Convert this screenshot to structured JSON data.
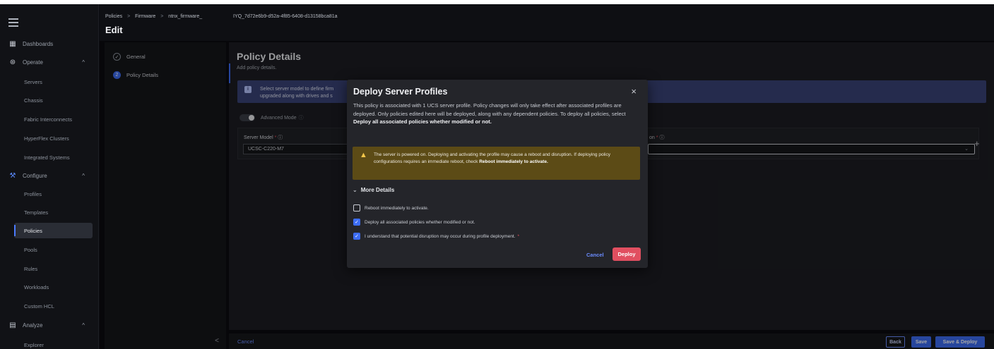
{
  "nav": {
    "items": [
      {
        "label": "Dashboards",
        "icon": "dashboard-icon"
      },
      {
        "label": "Operate",
        "icon": "operate-icon",
        "chevron": "^"
      },
      {
        "label": "Servers"
      },
      {
        "label": "Chassis"
      },
      {
        "label": "Fabric Interconnects"
      },
      {
        "label": "HyperFlex Clusters"
      },
      {
        "label": "Integrated Systems"
      },
      {
        "label": "Configure",
        "icon": "configure-icon",
        "chevron": "^"
      },
      {
        "label": "Profiles"
      },
      {
        "label": "Templates"
      },
      {
        "label": "Policies",
        "active": true
      },
      {
        "label": "Pools"
      },
      {
        "label": "Rules"
      },
      {
        "label": "Workloads"
      },
      {
        "label": "Custom HCL"
      },
      {
        "label": "Analyze",
        "icon": "analyze-icon",
        "chevron": "^"
      },
      {
        "label": "Explorer"
      }
    ]
  },
  "header": {
    "breadcrumb": [
      "Policies",
      "Firmware",
      "ntnx_firmware_"
    ],
    "breadcrumb_separator": ">",
    "title": "Edit",
    "id_text": "IYQ_7d72e6b9-d52a-4f85-6408-d13158bca81a"
  },
  "steps": {
    "items": [
      {
        "label": "General",
        "marker": "✓"
      },
      {
        "label": "Policy Details",
        "marker": "2"
      }
    ],
    "collapse": "<"
  },
  "main": {
    "title": "Policy Details",
    "subtitle": "Add policy details.",
    "banner_line1": "Select server model to define firm",
    "banner_line2": "upgraded along with drives and s",
    "advanced_mode": "Advanced Mode",
    "server_model_label": "Server Model",
    "server_model_value": "UCSC-C220-M7",
    "version_label": "on",
    "required_mark": "*",
    "info_mark": "ⓘ",
    "plus": "+"
  },
  "footer": {
    "cancel": "Cancel",
    "back": "Back",
    "save": "Save",
    "save_deploy": "Save & Deploy"
  },
  "modal": {
    "title": "Deploy Server Profiles",
    "close": "×",
    "desc_main": "This policy is associated with 1 UCS server profile. Policy changes will only take effect after associated profiles are deployed. Only policies edited here will be deployed, along with any dependent policies. To deploy all policies, select ",
    "desc_bold": "Deploy all associated policies whether modified or not.",
    "warning_main": "The server is powered on. Deploying and activating the profile may cause a reboot and disruption. If deploying policy configurations requires an immediate reboot, check ",
    "warning_bold": "Reboot immediately to activate.",
    "more_details": "More Details",
    "checkboxes": [
      {
        "label": "Reboot immediately to activate.",
        "checked": false
      },
      {
        "label": "Deploy all associated policies whether modified or not.",
        "checked": true
      },
      {
        "label": "I understand that potential disruption may occur during profile deployment.",
        "checked": true,
        "required": "*"
      }
    ],
    "cancel": "Cancel",
    "deploy": "Deploy"
  },
  "colors": {
    "accent": "#3c6cf2",
    "danger": "#e14f60",
    "warning_bg": "#5c4b16",
    "info_bg": "#394277"
  }
}
